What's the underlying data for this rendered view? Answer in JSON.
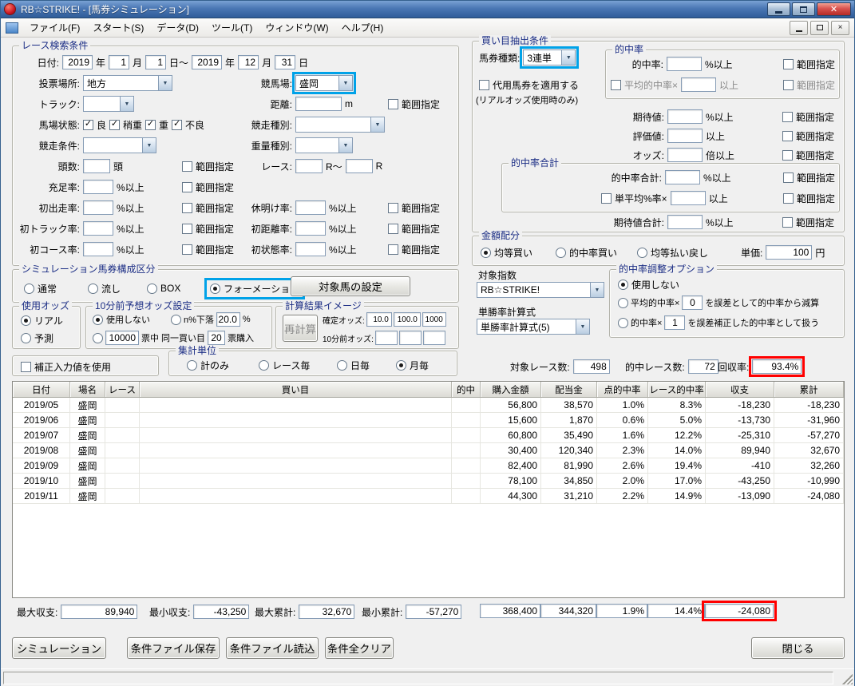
{
  "annotations": {
    "highlight_red": "#ff0000",
    "highlight_blue": "#00a2e8"
  },
  "window": {
    "title": "RB☆STRIKE! - [馬券シミュレーション]"
  },
  "menu": {
    "items": [
      "ファイル(F)",
      "スタート(S)",
      "データ(D)",
      "ツール(T)",
      "ウィンドウ(W)",
      "ヘルプ(H)"
    ]
  },
  "common": {
    "range": "範囲指定",
    "pct_above": "%以上",
    "above": "以上",
    "times_above": "倍以上"
  },
  "race_search": {
    "title": "レース検索条件",
    "date": {
      "label": "日付:",
      "from_year": "2019",
      "y": "年",
      "from_month": "1",
      "m": "月",
      "from_day": "1",
      "d_tilde": "日～",
      "to_year": "2019",
      "to_month": "12",
      "to_day": "31",
      "d": "日"
    },
    "place": {
      "label": "投票場所:",
      "value": "地方"
    },
    "course": {
      "label": "競馬場:",
      "value": "盛岡"
    },
    "track": {
      "label": "トラック:"
    },
    "distance": {
      "label": "距離:",
      "unit": "m"
    },
    "surface": {
      "label": "馬場状態:",
      "options": [
        "良",
        "稍重",
        "重",
        "不良"
      ]
    },
    "race_type": {
      "label": "競走種別:"
    },
    "race_cond": {
      "label": "競走条件:"
    },
    "weight_type": {
      "label": "重量種別:"
    },
    "heads": {
      "label": "頭数:",
      "unit": "頭"
    },
    "race_no": {
      "label": "レース:",
      "r1": "R～",
      "r2": "R"
    },
    "fill_rate": {
      "label": "充足率:"
    },
    "first_run": {
      "label": "初出走率:"
    },
    "rest": {
      "label": "休明け率:"
    },
    "first_track": {
      "label": "初トラック率:"
    },
    "first_distance": {
      "label": "初距離率:"
    },
    "first_course": {
      "label": "初コース率:"
    },
    "first_surface": {
      "label": "初状態率:"
    }
  },
  "extraction": {
    "title": "買い目抽出条件",
    "ticket_type": {
      "label": "馬券種類:",
      "value": "3連単"
    },
    "substitute": {
      "label": "代用馬券を適用する",
      "note": "(リアルオッズ使用時のみ)"
    },
    "hit_group": {
      "title": "的中率",
      "hit_label": "的中率:",
      "avg_label": "平均的中率×"
    },
    "expected": {
      "label": "期待値:"
    },
    "evaluation": {
      "label": "評価値:"
    },
    "odds": {
      "label": "オッズ:"
    },
    "hit_total_group": {
      "title": "的中率合計",
      "total_label": "的中率合計:",
      "single_avg_label": "単平均%率×"
    },
    "expected_total": {
      "label": "期待値合計:"
    }
  },
  "allocation": {
    "title": "金額配分",
    "options": [
      "均等買い",
      "的中率買い",
      "均等払い戻し"
    ],
    "unit": {
      "label": "単価:",
      "value": "100",
      "suffix": "円"
    }
  },
  "target_index": {
    "label": "対象指数",
    "value": "RB☆STRIKE!"
  },
  "win_formula": {
    "label": "単勝率計算式",
    "value": "単勝率計算式(5)"
  },
  "hit_adjust": {
    "title": "的中率調整オプション",
    "opt_none": "使用しない",
    "opt2": {
      "pre": "平均的中率×",
      "value": "0",
      "post": "を誤差として的中率から減算"
    },
    "opt3": {
      "pre": "的中率×",
      "value": "1",
      "post": "を誤差補正した的中率として扱う"
    }
  },
  "composition": {
    "title": "シミュレーション馬券構成区分",
    "options": [
      "通常",
      "流し",
      "BOX",
      "フォーメーション"
    ],
    "target_button": "対象馬の設定"
  },
  "odds_source": {
    "title": "使用オッズ",
    "options": [
      "リアル",
      "予測"
    ]
  },
  "pre_odds": {
    "title": "10分前予想オッズ設定",
    "opt_none": "使用しない",
    "drop": {
      "label": "n%下落",
      "value": "20.0",
      "suffix": "%"
    },
    "votes": {
      "value": "10000",
      "mid": "票中 同一買い目",
      "count": "20",
      "suffix": "票購入"
    }
  },
  "calc_image": {
    "title": "計算結果イメージ",
    "recalc": "再計算",
    "fixed_label": "確定オッズ:",
    "fixed": [
      "10.0",
      "100.0",
      "1000"
    ],
    "pre_label": "10分前オッズ:"
  },
  "correction": {
    "label": "補正入力値を使用"
  },
  "aggregation": {
    "title": "集計単位",
    "options": [
      "計のみ",
      "レース毎",
      "日毎",
      "月毎"
    ]
  },
  "stats": {
    "races_label": "対象レース数:",
    "races": "498",
    "hits_label": "的中レース数:",
    "hits": "72",
    "recovery_label": "回収率:",
    "recovery": "93.4%"
  },
  "table": {
    "headers": [
      "日付",
      "場名",
      "レース",
      "買い目",
      "的中",
      "購入金額",
      "配当金",
      "点的中率",
      "レース的中率",
      "収支",
      "累計"
    ],
    "rows": [
      {
        "date": "2019/05",
        "place": "盛岡",
        "race": "",
        "bet": "",
        "hit": "",
        "purchase": "56,800",
        "payout": "38,570",
        "point_rate": "1.0%",
        "race_rate": "8.3%",
        "balance": "-18,230",
        "total": "-18,230"
      },
      {
        "date": "2019/06",
        "place": "盛岡",
        "race": "",
        "bet": "",
        "hit": "",
        "purchase": "15,600",
        "payout": "1,870",
        "point_rate": "0.6%",
        "race_rate": "5.0%",
        "balance": "-13,730",
        "total": "-31,960"
      },
      {
        "date": "2019/07",
        "place": "盛岡",
        "race": "",
        "bet": "",
        "hit": "",
        "purchase": "60,800",
        "payout": "35,490",
        "point_rate": "1.6%",
        "race_rate": "12.2%",
        "balance": "-25,310",
        "total": "-57,270"
      },
      {
        "date": "2019/08",
        "place": "盛岡",
        "race": "",
        "bet": "",
        "hit": "",
        "purchase": "30,400",
        "payout": "120,340",
        "point_rate": "2.3%",
        "race_rate": "14.0%",
        "balance": "89,940",
        "total": "32,670"
      },
      {
        "date": "2019/09",
        "place": "盛岡",
        "race": "",
        "bet": "",
        "hit": "",
        "purchase": "82,400",
        "payout": "81,990",
        "point_rate": "2.6%",
        "race_rate": "19.4%",
        "balance": "-410",
        "total": "32,260"
      },
      {
        "date": "2019/10",
        "place": "盛岡",
        "race": "",
        "bet": "",
        "hit": "",
        "purchase": "78,100",
        "payout": "34,850",
        "point_rate": "2.0%",
        "race_rate": "17.0%",
        "balance": "-43,250",
        "total": "-10,990"
      },
      {
        "date": "2019/11",
        "place": "盛岡",
        "race": "",
        "bet": "",
        "hit": "",
        "purchase": "44,300",
        "payout": "31,210",
        "point_rate": "2.2%",
        "race_rate": "14.9%",
        "balance": "-13,090",
        "total": "-24,080"
      }
    ]
  },
  "summary": {
    "max_balance_label": "最大収支:",
    "max_balance": "89,940",
    "min_balance_label": "最小収支:",
    "min_balance": "-43,250",
    "max_total_label": "最大累計:",
    "max_total": "32,670",
    "min_total_label": "最小累計:",
    "min_total": "-57,270",
    "purchase": "368,400",
    "payout": "344,320",
    "point_rate": "1.9%",
    "race_rate": "14.4%",
    "balance": "-24,080"
  },
  "buttons": {
    "simulation": "シミュレーション",
    "save": "条件ファイル保存",
    "load": "条件ファイル読込",
    "clear": "条件全クリア",
    "close": "閉じる"
  }
}
